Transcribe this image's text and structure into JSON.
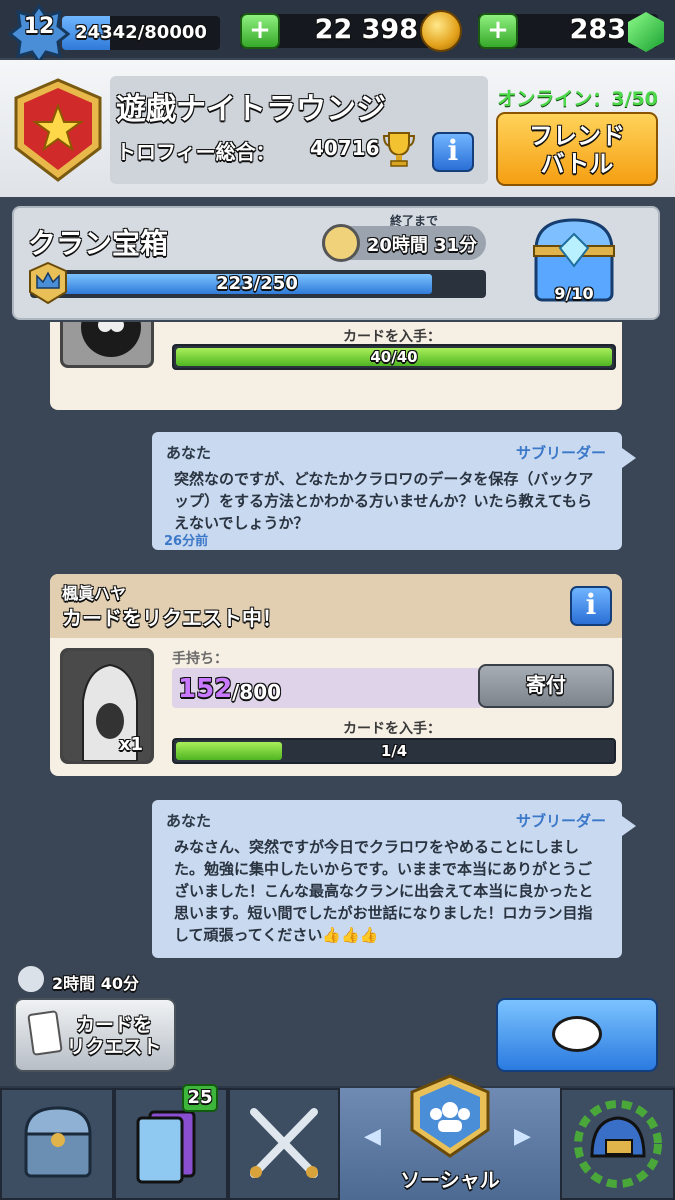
{
  "player": {
    "level": "12",
    "xp": "24342/80000",
    "xp_fraction": 0.304
  },
  "resources": {
    "gold": "22 398",
    "gems": "283",
    "plus": "+"
  },
  "clan": {
    "name": "遊戯ナイトラウンジ",
    "trophy_label": "トロフィー総合：",
    "trophy_value": "40716",
    "info": "i",
    "online": "オンライン：3/50",
    "friend_battle": "フレンド\nバトル"
  },
  "clan_chest": {
    "title": "クラン宝箱",
    "until_label": "終了まで",
    "timer": "20時間 31分",
    "progress_text": "223/250",
    "progress_fraction": 0.892,
    "chest_count": "9/10"
  },
  "messages": [
    {
      "type": "card_request_partial",
      "get_label": "カードを入手：",
      "bar_text": "40/40",
      "fraction": 1.0
    },
    {
      "type": "chat",
      "name": "あなた",
      "role": "サブリーダー",
      "text": "突然なのですが、どなたかクラロワのデータを保存（バックアップ）をする方法とかわかる方いませんか？いたら教えてもらえないでしょうか？",
      "time": "26分前"
    },
    {
      "type": "card_request",
      "name": "楓眞ハヤ",
      "title": "カードをリクエスト中！",
      "owned_label": "手持ち：",
      "owned_value": "152",
      "owned_total": "/800",
      "donate": "寄付",
      "card_count": "x1",
      "get_label": "カードを入手：",
      "bar_text": "1/4",
      "fraction": 0.25
    },
    {
      "type": "chat",
      "name": "あなた",
      "role": "サブリーダー",
      "text": "みなさん、突然ですが今日でクラロワをやめることにしました。勉強に集中したいからです。いままで本当にありがとうございました！こんな最高なクランに出会えて本当に良かったと思います。短い間でしたがお世話になりました！ロカラン目指して頑張ってください👍👍👍"
    }
  ],
  "bottom": {
    "cooldown": "2時間 40分",
    "request_button": "カードを\nリクエスト"
  },
  "nav": {
    "active_label": "ソーシャル",
    "cards_badge": "25",
    "tabs": [
      "shop",
      "cards",
      "battle",
      "social",
      "tournaments"
    ]
  },
  "colors": {
    "accent_blue": "#2f7ad8",
    "gold": "#f59f12",
    "green": "#4fb522",
    "online_green": "#4dd84a"
  }
}
